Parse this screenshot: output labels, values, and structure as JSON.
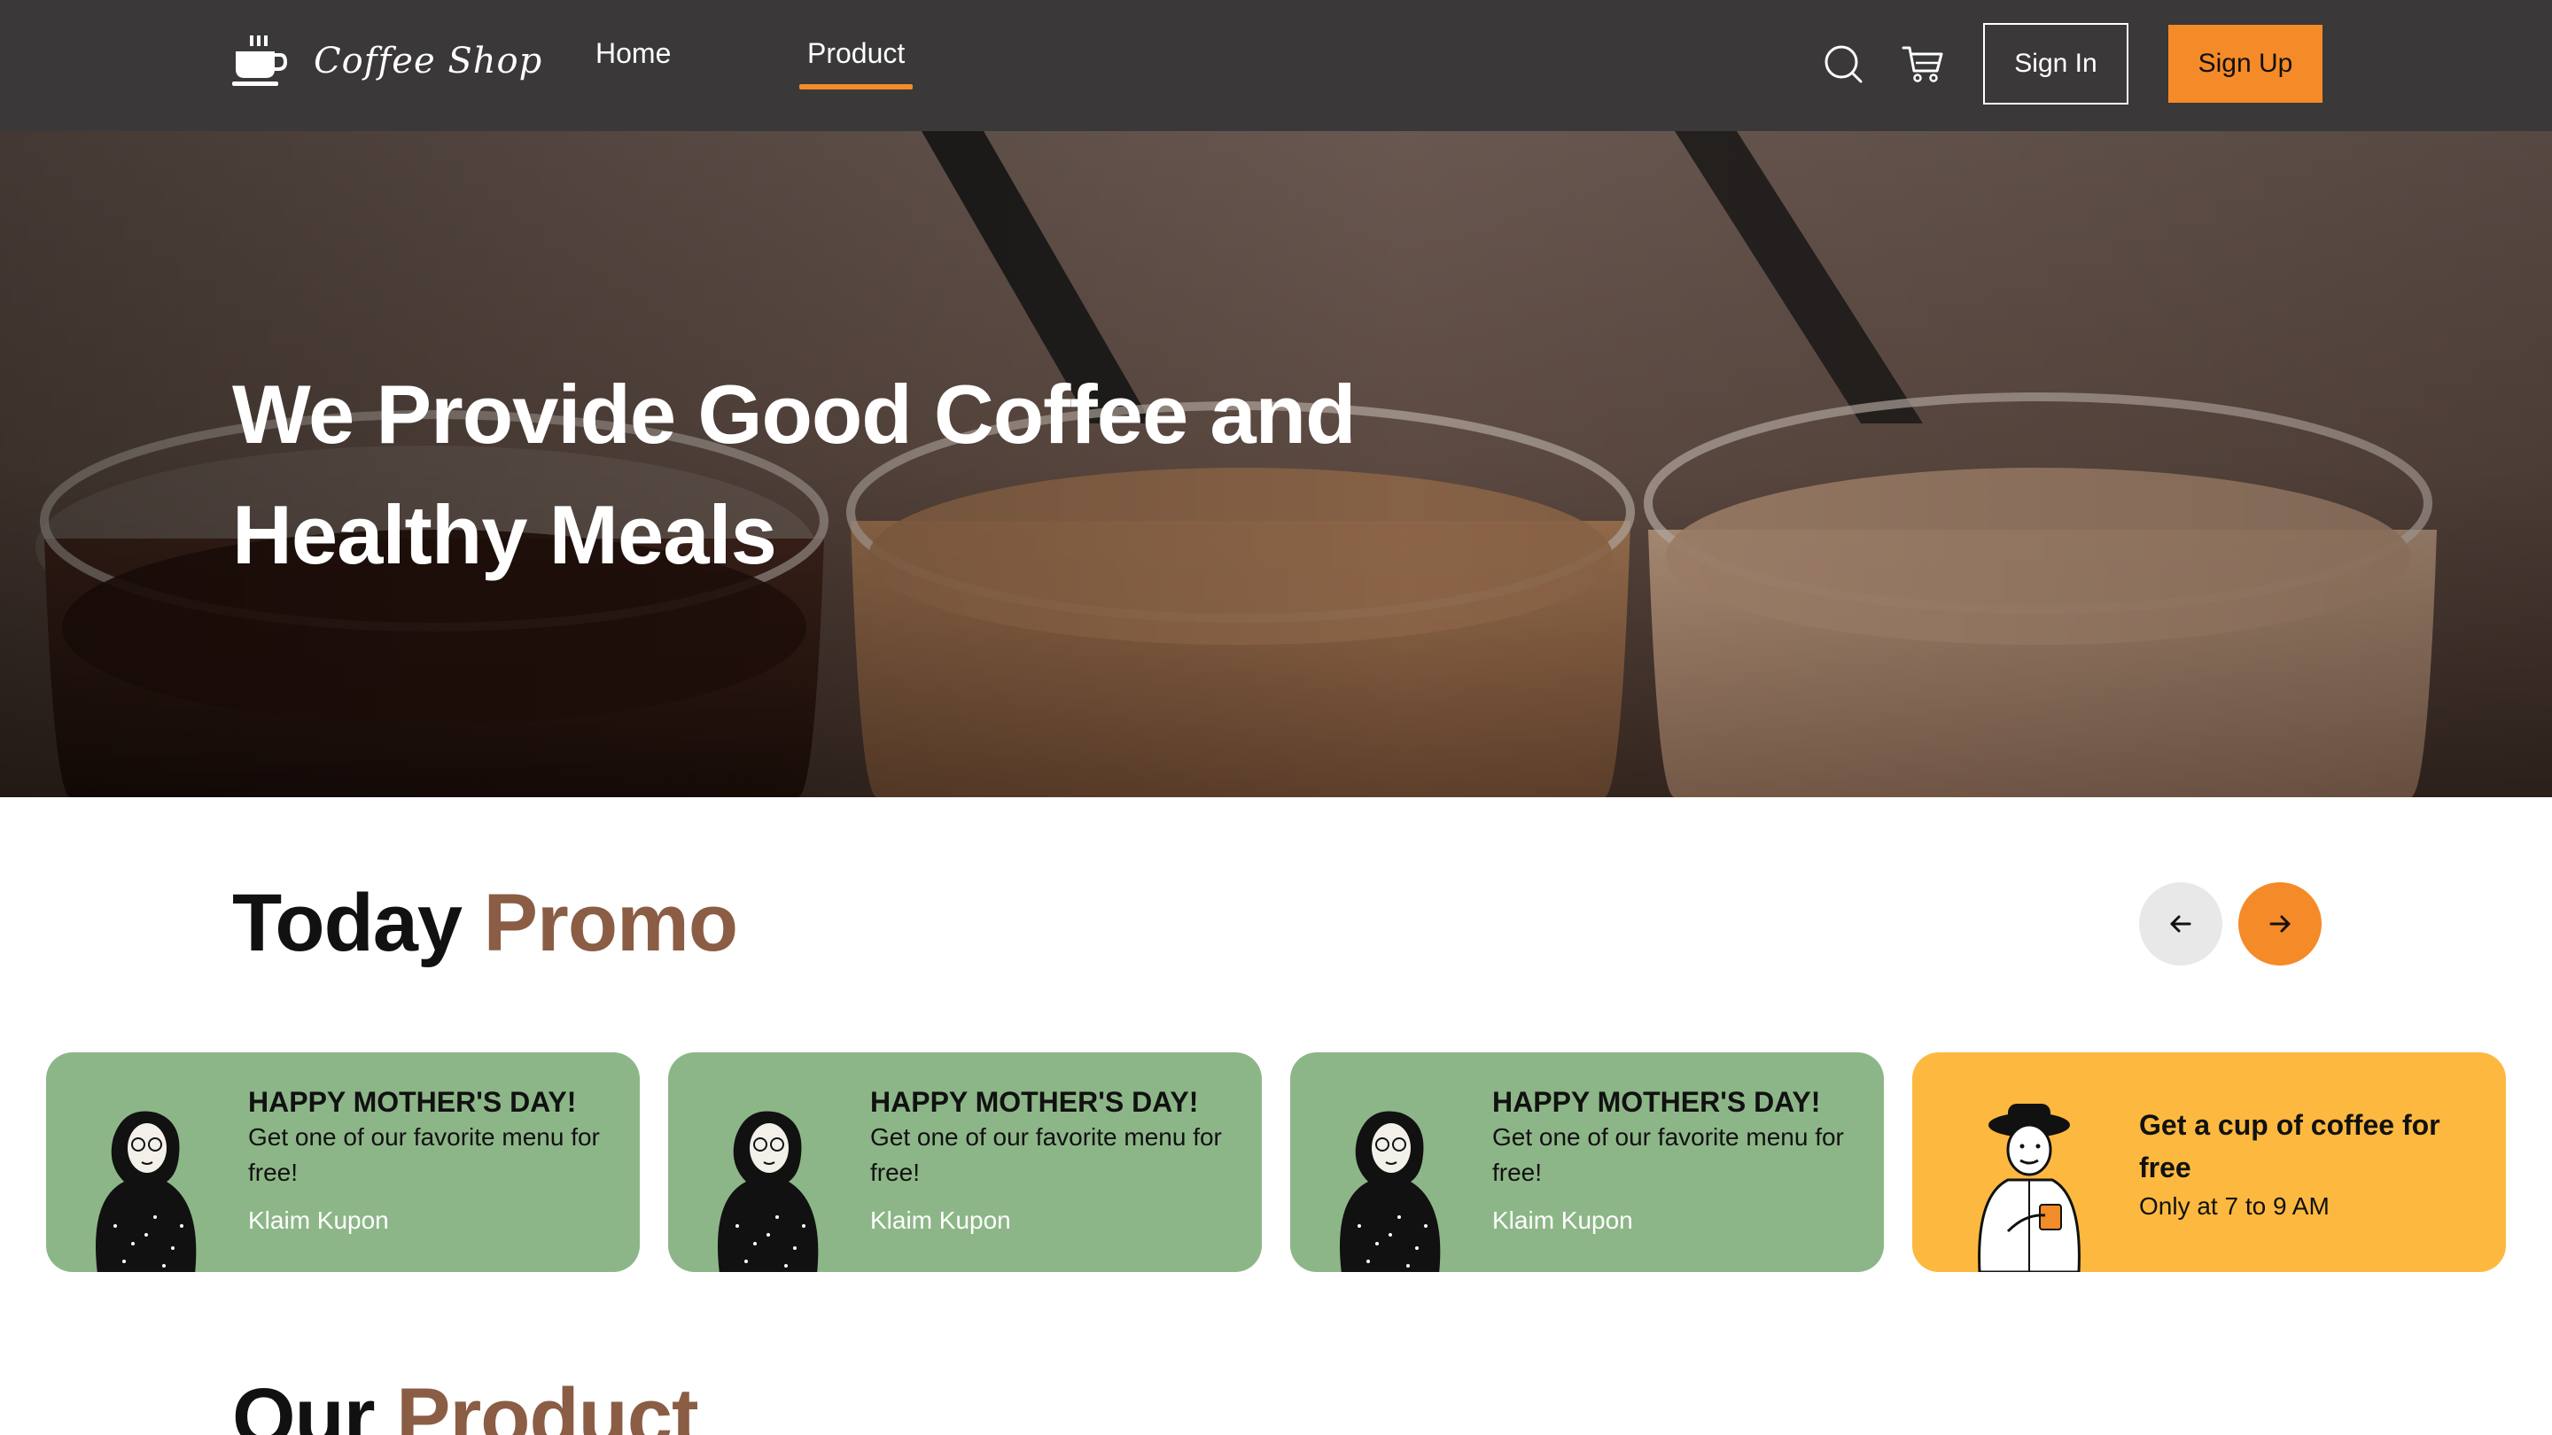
{
  "brand": {
    "name": "Coffee Shop"
  },
  "nav": {
    "links": [
      {
        "label": "Home",
        "active": false
      },
      {
        "label": "Product",
        "active": true
      }
    ],
    "sign_in": "Sign In",
    "sign_up": "Sign Up",
    "icons": [
      "coffee-cup-icon",
      "search-icon",
      "cart-icon"
    ]
  },
  "hero": {
    "title": "We Provide Good Coffee and Healthy Meals"
  },
  "promo": {
    "title_main": "Today",
    "title_accent": "Promo",
    "cards": [
      {
        "title": "HAPPY MOTHER'S DAY!",
        "desc": "Get one of our favorite menu for free!",
        "link": "Klaim Kupon",
        "color": "#8db688"
      },
      {
        "title": "HAPPY MOTHER'S DAY!",
        "desc": "Get one of our favorite menu for free!",
        "link": "Klaim Kupon",
        "color": "#8db688"
      },
      {
        "title": "HAPPY MOTHER'S DAY!",
        "desc": "Get one of our favorite menu for free!",
        "link": "Klaim Kupon",
        "color": "#8db688"
      },
      {
        "title": "Get a cup of coffee for free",
        "desc": "Only at 7 to 9 AM",
        "color": "#fdb93f"
      }
    ]
  },
  "product": {
    "title_main": "Our",
    "title_accent": "Product"
  },
  "colors": {
    "navbar": "#3a3839",
    "accent": "#f58a28",
    "brown": "#8a5d44",
    "green_card": "#8db688",
    "yellow_card": "#fdb93f"
  }
}
